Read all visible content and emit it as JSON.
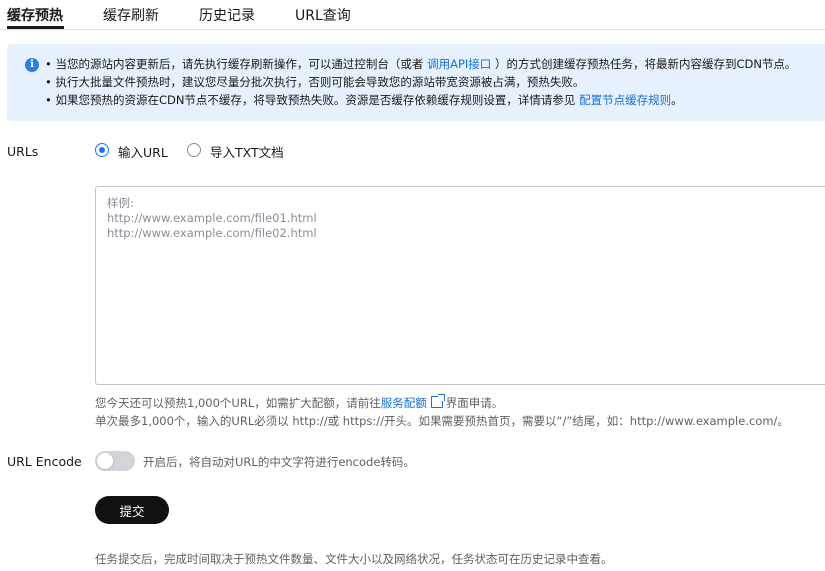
{
  "tabs": [
    {
      "label": "缓存预热",
      "active": true
    },
    {
      "label": "缓存刷新",
      "active": false
    },
    {
      "label": "历史记录",
      "active": false
    },
    {
      "label": "URL查询",
      "active": false
    }
  ],
  "banner": {
    "icon": "info-icon",
    "line1_pre": "• 当您的源站内容更新后，请先执行缓存刷新操作，可以通过控制台（或者 ",
    "line1_link": "调用API接口",
    "line1_post": " ）的方式创建缓存预热任务，将最新内容缓存到CDN节点。",
    "line2": "• 执行大批量文件预热时，建议您尽量分批次执行，否则可能会导致您的源站带宽资源被占满，预热失败。",
    "line3_pre": "• 如果您预热的资源在CDN节点不缓存，将导致预热失败。资源是否缓存依赖缓存规则设置，详情请参见 ",
    "line3_link": "配置节点缓存规则",
    "line3_post": "。"
  },
  "urls": {
    "label": "URLs",
    "radio_input": "输入URL",
    "radio_import": "导入TXT文档",
    "selected": "输入URL",
    "placeholder": "样例:\nhttp://www.example.com/file01.html\nhttp://www.example.com/file02.html",
    "value": "",
    "hint1_pre": "您今天还可以预热1,000个URL，如需扩大配额，请前往",
    "hint1_link": "服务配额",
    "hint1_post": "界面申请。",
    "hint2": "单次最多1,000个，输入的URL必须以 http://或 https://开头。如果需要预热首页，需要以“/”结尾，如：http://www.example.com/。"
  },
  "url_encode": {
    "label": "URL Encode",
    "enabled": false,
    "description": "开启后，将自动对URL的中文字符进行encode转码。"
  },
  "submit_label": "提交",
  "footer_note": "任务提交后，完成时间取决于预热文件数量、文件大小以及网络状况，任务状态可在历史记录中查看。",
  "colors": {
    "banner_bg": "#e6f1fd",
    "link": "#1a6ed8",
    "primary_button": "#111111",
    "radio_checked": "#1476ff",
    "toggle_off": "#d2d4d9"
  }
}
